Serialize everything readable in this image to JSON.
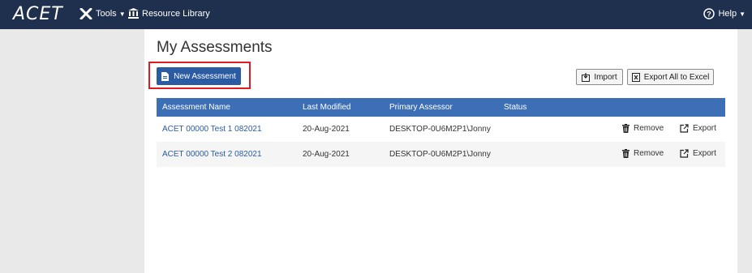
{
  "topbar": {
    "logo": "ACET",
    "tools_label": "Tools",
    "resource_library_label": "Resource Library",
    "help_label": "Help",
    "bg_color": "#1f2f4e"
  },
  "page": {
    "title": "My Assessments",
    "new_assessment_label": "New Assessment",
    "import_label": "Import",
    "export_all_label": "Export All to Excel"
  },
  "table": {
    "headers": [
      "Assessment Name",
      "Last Modified",
      "Primary Assessor",
      "Status"
    ],
    "header_color": "#3d6fb6",
    "rows": [
      {
        "name": "ACET 00000 Test 1 082021",
        "last_modified": "20-Aug-2021",
        "assessor": "DESKTOP-0U6M2P1\\Jonny",
        "status": "",
        "remove_label": "Remove",
        "export_label": "Export"
      },
      {
        "name": "ACET 00000 Test 2 082021",
        "last_modified": "20-Aug-2021",
        "assessor": "DESKTOP-0U6M2P1\\Jonny",
        "status": "",
        "remove_label": "Remove",
        "export_label": "Export"
      }
    ]
  },
  "icons": [
    "tools-icon",
    "library-icon",
    "help-icon",
    "document-icon",
    "import-icon",
    "excel-icon",
    "trash-icon",
    "export-icon"
  ]
}
